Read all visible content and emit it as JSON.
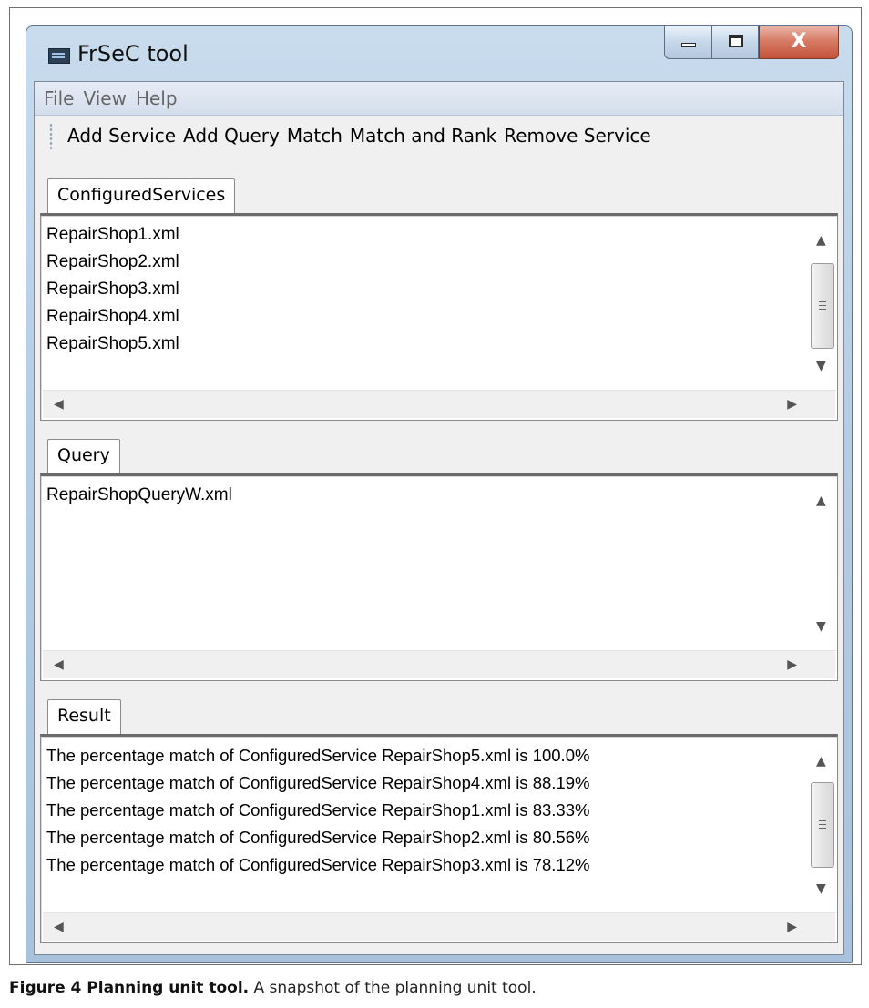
{
  "window": {
    "title": "FrSeC tool",
    "close_glyph": "X"
  },
  "menu": {
    "items": [
      "File",
      "View",
      "Help"
    ]
  },
  "toolbar": {
    "buttons": [
      "Add Service",
      "Add Query",
      "Match",
      "Match and Rank",
      "Remove Service"
    ]
  },
  "services": {
    "tab_label": "ConfiguredServices",
    "items": [
      "RepairShop1.xml",
      "RepairShop2.xml",
      "RepairShop3.xml",
      "RepairShop4.xml",
      "RepairShop5.xml"
    ]
  },
  "query": {
    "tab_label": "Query",
    "items": [
      "RepairShopQueryW.xml"
    ]
  },
  "result": {
    "tab_label": "Result",
    "items": [
      "The percentage match of ConfiguredService RepairShop5.xml is 100.0%",
      "The percentage match of ConfiguredService RepairShop4.xml is 88.19%",
      "The percentage match of ConfiguredService RepairShop1.xml is 83.33%",
      "The percentage match of ConfiguredService RepairShop2.xml is 80.56%",
      "The percentage match of ConfiguredService RepairShop3.xml is 78.12%"
    ]
  },
  "caption": {
    "label": "Figure 4 Planning unit tool.",
    "text": " A snapshot of the planning unit tool."
  },
  "icons": {
    "app": "app-window-icon",
    "scroll_up": "▲",
    "scroll_down": "▼",
    "scroll_left": "◀",
    "scroll_right": "▶"
  }
}
